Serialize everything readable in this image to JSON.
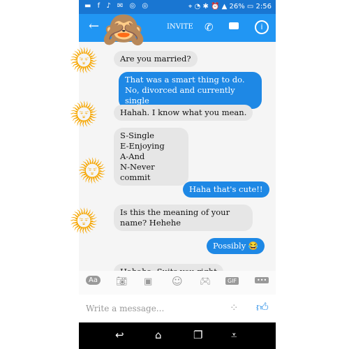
{
  "status_bar": {
    "left_icons": "▬ f ♪ ✉ ◎ ◎",
    "right_text": "⌖ ◔ ✱ ⏰ ▲ 26% ▭ 2:56",
    "battery": "26%",
    "time": "2:56"
  },
  "header": {
    "invite_label": "INVITE"
  },
  "messages": [
    {
      "side": "received",
      "text": "Are you married?"
    },
    {
      "side": "sent",
      "text": "That was a smart thing to do. No, divorced and currently single"
    },
    {
      "side": "received",
      "text": "Hahah. I know what you mean."
    },
    {
      "side": "received",
      "text": "S-Single\nE-Enjoying\nA-And\nN-Never commit"
    },
    {
      "side": "sent",
      "text": "Haha that's cute!!"
    },
    {
      "side": "received",
      "text": "Is this the meaning of your name? Hehehe"
    },
    {
      "side": "sent",
      "text": "Possibly 😂"
    },
    {
      "side": "received",
      "text": "Hahaha. Suits you right"
    }
  ],
  "toolbar": {
    "aa": "Aa",
    "gif": "GIF"
  },
  "composer": {
    "placeholder": "Write a message..."
  },
  "colors": {
    "header": "#2196f3",
    "status": "#1976d2",
    "sent_bubble": "#1e88e5",
    "received_bubble": "#e6e6e6"
  }
}
